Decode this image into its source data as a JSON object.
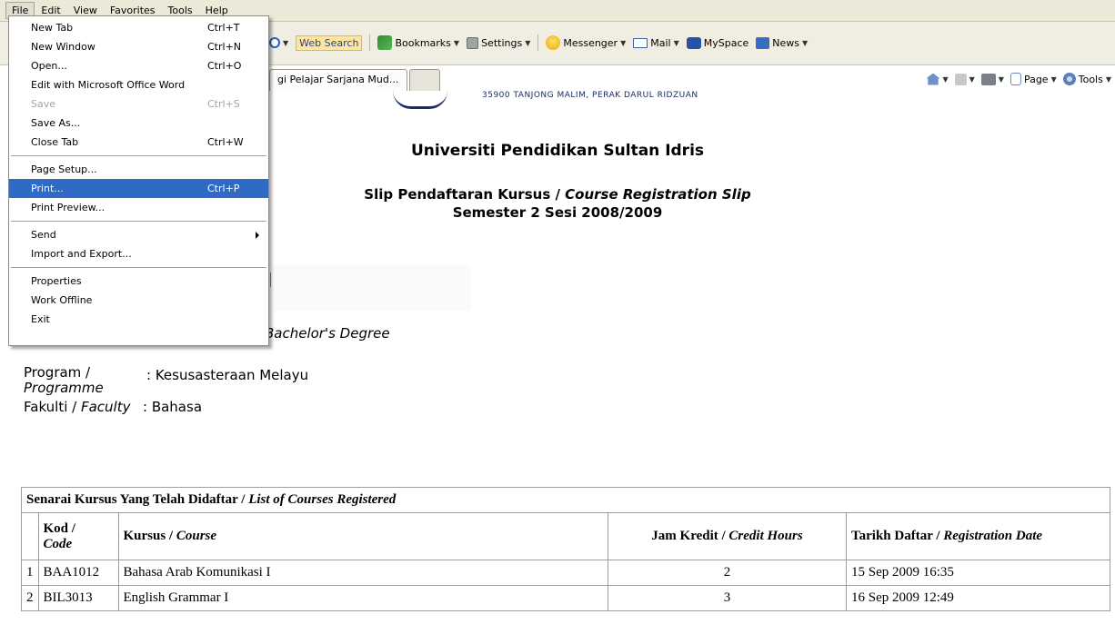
{
  "menubar": {
    "items": [
      "File",
      "Edit",
      "View",
      "Favorites",
      "Tools",
      "Help"
    ]
  },
  "linksbar": {
    "web_search": "Web Search",
    "bookmarks": "Bookmarks",
    "settings": "Settings",
    "messenger": "Messenger",
    "mail": "Mail",
    "myspace": "MySpace",
    "news": "News"
  },
  "tab": {
    "title": "gi Pelajar Sarjana Mud..."
  },
  "cmdbar": {
    "page": "Page",
    "tools": "Tools"
  },
  "file_menu": {
    "new_tab": {
      "label": "New Tab",
      "shortcut": "Ctrl+T"
    },
    "new_window": {
      "label": "New Window",
      "shortcut": "Ctrl+N"
    },
    "open": {
      "label": "Open...",
      "shortcut": "Ctrl+O"
    },
    "edit_word": {
      "label": "Edit with Microsoft Office Word"
    },
    "save": {
      "label": "Save",
      "shortcut": "Ctrl+S"
    },
    "save_as": {
      "label": "Save As..."
    },
    "close_tab": {
      "label": "Close Tab",
      "shortcut": "Ctrl+W"
    },
    "page_setup": {
      "label": "Page Setup..."
    },
    "print": {
      "label": "Print...",
      "shortcut": "Ctrl+P"
    },
    "print_preview": {
      "label": "Print Preview..."
    },
    "send": {
      "label": "Send"
    },
    "import_export": {
      "label": "Import and Export..."
    },
    "properties": {
      "label": "Properties"
    },
    "work_offline": {
      "label": "Work Offline"
    },
    "exit": {
      "label": "Exit"
    }
  },
  "page": {
    "address_line": "35900 TANJONG MALIM, PERAK DARUL RIDZUAN",
    "university": "Universiti Pendidikan Sultan Idris",
    "slip_title_ms": "Slip Pendaftaran Kursus / ",
    "slip_title_en": "Course Registration Slip",
    "semester": "Semester 2 Sesi 2008/2009",
    "degree_partial": "Bachelor's Degree",
    "program_label_ms": "Program /",
    "program_label_en": "Programme",
    "program_value": ": Kesusasteraan Melayu",
    "faculty_label_ms": "Fakulti / ",
    "faculty_label_en": "Faculty",
    "faculty_value": ": Bahasa"
  },
  "courses": {
    "caption_ms": "Senarai Kursus Yang Telah Didaftar / ",
    "caption_en": "List of Courses Registered",
    "headers": {
      "code_ms": "Kod /",
      "code_en": "Code",
      "course_ms": "Kursus / ",
      "course_en": "Course",
      "hours_ms": "Jam Kredit / ",
      "hours_en": "Credit Hours",
      "date_ms": "Tarikh Daftar / ",
      "date_en": "Registration Date"
    },
    "rows": [
      {
        "no": "1",
        "code": "BAA1012",
        "course": "Bahasa Arab Komunikasi I",
        "hours": "2",
        "date": "15 Sep 2009 16:35"
      },
      {
        "no": "2",
        "code": "BIL3013",
        "course": "English Grammar I",
        "hours": "3",
        "date": "16 Sep 2009 12:49"
      }
    ]
  }
}
